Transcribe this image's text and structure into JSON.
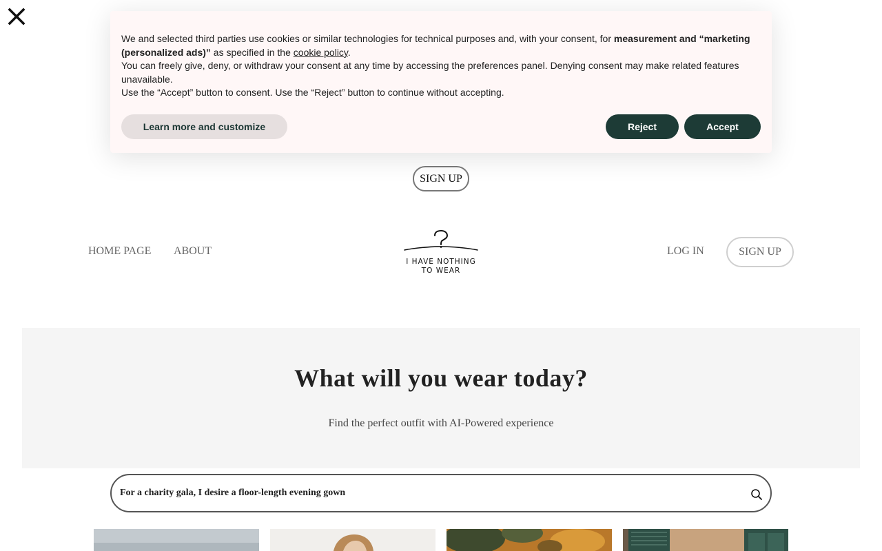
{
  "close_button": {
    "icon": "close-icon"
  },
  "cookie_banner": {
    "intro_text": "We and selected third parties use cookies or similar technologies for technical purposes and, with your consent, for ",
    "bold_text": "measurement and “marketing (personalized ads)”",
    "spec_text": " as specified in the ",
    "policy_link": "cookie policy",
    "period": ".",
    "line2": "You can freely give, deny, or withdraw your consent at any time by accessing the preferences panel. Denying consent may make related features unavailable.",
    "line3": "Use the “Accept” button to consent. Use the “Reject” button to continue without accepting.",
    "customize_label": "Learn more and customize",
    "reject_label": "Reject",
    "accept_label": "Accept",
    "colors": {
      "background": "#fff7f7",
      "primary_button": "#1d3b36",
      "secondary_button": "#e6dfdf"
    }
  },
  "top_signup": {
    "label": "SIGN UP"
  },
  "nav": {
    "home": "HOME PAGE",
    "about": "ABOUT",
    "login": "LOG IN",
    "signup": "SIGN UP"
  },
  "logo": {
    "icon": "hanger-question-icon",
    "line1": "I HAVE NOTHING",
    "line2": "TO WEAR"
  },
  "hero": {
    "title": "What will you wear today?",
    "subtitle": "Find the perfect outfit with AI-Powered experience"
  },
  "search": {
    "value": "For a charity gala, I desire a floor-length evening gown",
    "icon": "search-icon"
  },
  "cards": [
    {
      "name": "outfit-card-1"
    },
    {
      "name": "outfit-card-2"
    },
    {
      "name": "outfit-card-3"
    },
    {
      "name": "outfit-card-4"
    }
  ]
}
